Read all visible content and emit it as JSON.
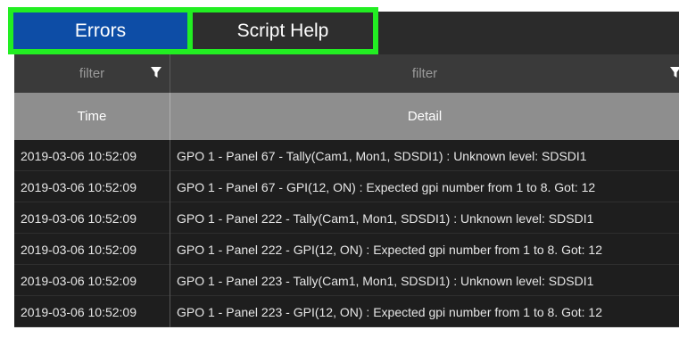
{
  "tabs": {
    "errors_label": "Errors",
    "script_help_label": "Script Help"
  },
  "filters": {
    "time_placeholder": "filter",
    "detail_placeholder": "filter"
  },
  "columns": {
    "time": "Time",
    "detail": "Detail"
  },
  "rows": [
    {
      "time": "2019-03-06 10:52:09",
      "detail": "GPO 1 - Panel 67 - Tally(Cam1, Mon1, SDSDI1) : Unknown level: SDSDI1"
    },
    {
      "time": "2019-03-06 10:52:09",
      "detail": "GPO 1 - Panel 67 - GPI(12, ON) : Expected gpi number from 1 to 8. Got: 12"
    },
    {
      "time": "2019-03-06 10:52:09",
      "detail": "GPO 1 - Panel 222 - Tally(Cam1, Mon1, SDSDI1) : Unknown level: SDSDI1"
    },
    {
      "time": "2019-03-06 10:52:09",
      "detail": "GPO 1 - Panel 222 - GPI(12, ON) : Expected gpi number from 1 to 8. Got: 12"
    },
    {
      "time": "2019-03-06 10:52:09",
      "detail": "GPO 1 - Panel 223 - Tally(Cam1, Mon1, SDSDI1) : Unknown level: SDSDI1"
    },
    {
      "time": "2019-03-06 10:52:09",
      "detail": "GPO 1 - Panel 223 - GPI(12, ON) : Expected gpi number from 1 to 8. Got: 12"
    }
  ],
  "colors": {
    "active_tab": "#0d4da6",
    "highlight": "#22ee22",
    "row_bg": "#1e1e1e",
    "header_bg": "#8e8e8e"
  }
}
